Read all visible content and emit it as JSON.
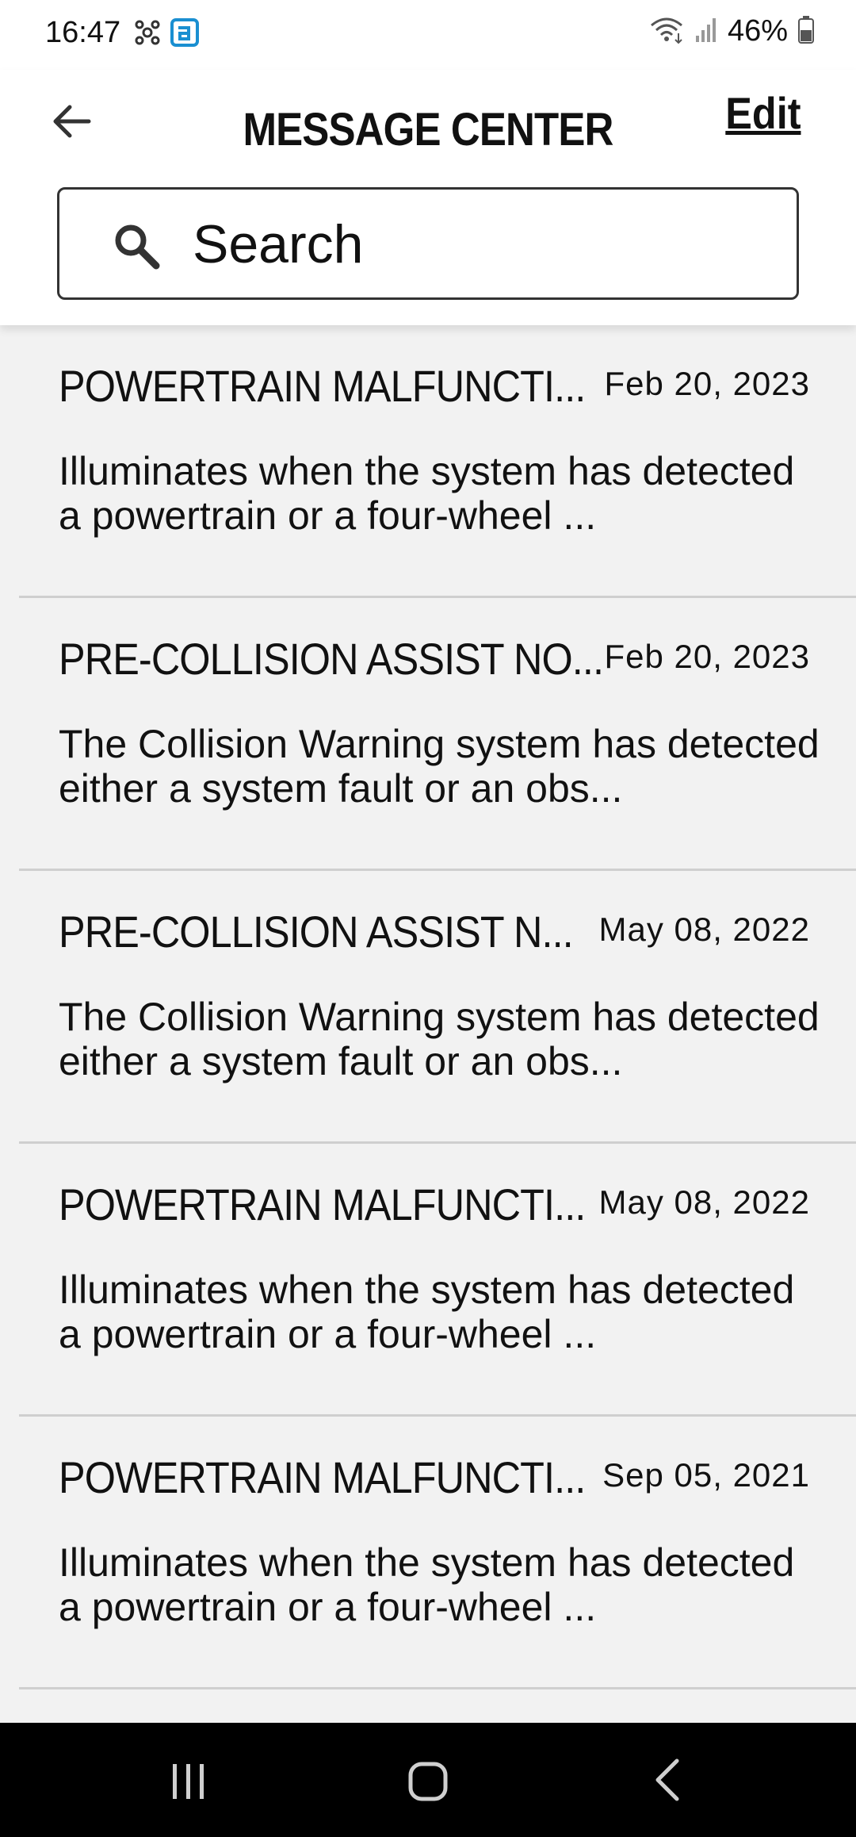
{
  "status_bar": {
    "time": "16:47",
    "battery": "46%",
    "icons_left": [
      "network-icon",
      "app-logo-icon"
    ],
    "icons_right": [
      "wifi-icon",
      "signal-icon",
      "battery-icon"
    ]
  },
  "header": {
    "title": "MESSAGE CENTER",
    "edit_label": "Edit",
    "back_icon": "arrow-left-icon"
  },
  "search": {
    "placeholder": "Search"
  },
  "messages": [
    {
      "title": "POWERTRAIN MALFUNCTI...",
      "date": "Feb 20, 2023",
      "body": "Illuminates when the system has detected a powertrain or a four-wheel ..."
    },
    {
      "title": "PRE-COLLISION ASSIST NO...",
      "date": "Feb 20, 2023",
      "body": "The Collision Warning system has detected either a system fault or an obs..."
    },
    {
      "title": "PRE-COLLISION ASSIST N...",
      "date": "May 08, 2022",
      "body": "The Collision Warning system has detected either a system fault or an obs..."
    },
    {
      "title": "POWERTRAIN MALFUNCTI...",
      "date": "May 08, 2022",
      "body": "Illuminates when the system has detected a powertrain or a four-wheel ..."
    },
    {
      "title": "POWERTRAIN MALFUNCTI...",
      "date": "Sep 05, 2021",
      "body": "Illuminates when the system has detected a powertrain or a four-wheel ..."
    }
  ],
  "nav_bar": {
    "buttons": [
      "recent-apps-icon",
      "home-icon",
      "back-icon"
    ]
  },
  "colors": {
    "background": "#f2f2f2",
    "header_bg": "#ffffff",
    "nav_bg": "#000000",
    "text": "#111111",
    "divider": "#cfcfcf",
    "app_logo": "#1a8fd1"
  }
}
